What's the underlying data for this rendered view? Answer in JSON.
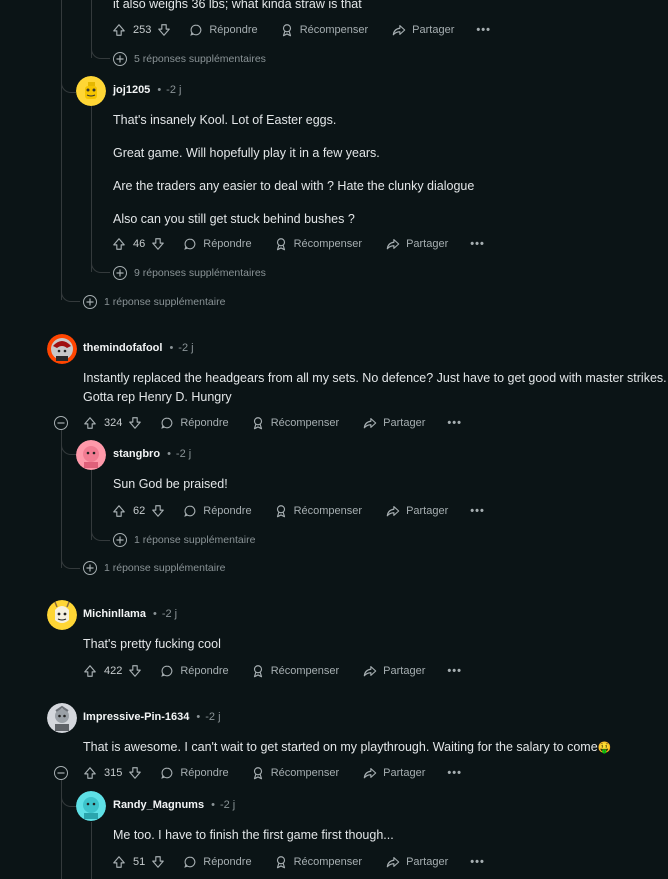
{
  "labels": {
    "reply": "Répondre",
    "award": "Récompenser",
    "share": "Partager",
    "more": "•••"
  },
  "top": {
    "partial_text": "it also weighs 36 lbs; what kinda straw is that",
    "votes": "253",
    "more_replies": "5 réponses supplémentaires"
  },
  "c_joj": {
    "author": "joj1205",
    "time": "-2 j",
    "lines": [
      "That's insanely Kool. Lot of Easter eggs.",
      "Great game. Will hopefully play it in a few years.",
      "Are the traders any easier to deal with ? Hate the clunky dialogue",
      "Also can you still get stuck behind bushes ?"
    ],
    "votes": "46",
    "more_replies": "9 réponses supplémentaires"
  },
  "outer_more_1": "1 réponse supplémentaire",
  "c_themind": {
    "author": "themindofafool",
    "time": "-2 j",
    "lines": [
      "Instantly replaced the headgears from all my sets. No defence? Just have to get good with master strikes.",
      "Gotta rep Henry D. Hungry"
    ],
    "votes": "324"
  },
  "c_stang": {
    "author": "stangbro",
    "time": "-2 j",
    "lines": [
      "Sun God be praised!"
    ],
    "votes": "62",
    "more_replies": "1 réponse supplémentaire"
  },
  "outer_more_2": "1 réponse supplémentaire",
  "c_michin": {
    "author": "Michinllama",
    "time": "-2 j",
    "lines": [
      "That's pretty fucking cool"
    ],
    "votes": "422"
  },
  "c_impressive": {
    "author": "Impressive-Pin-1634",
    "time": "-2 j",
    "lines": [
      "That is awesome. I can't wait to get started on my playthrough. Waiting for the salary to come"
    ],
    "emoji": "🤑",
    "votes": "315"
  },
  "c_randy": {
    "author": "Randy_Magnums",
    "time": "-2 j",
    "lines": [
      "Me too. I have to finish the first game first though..."
    ],
    "votes": "51"
  },
  "colors": {
    "background": "#0b1416",
    "thread_line": "#343a3c",
    "text": "#e3e6e8",
    "muted": "#8a9396"
  }
}
